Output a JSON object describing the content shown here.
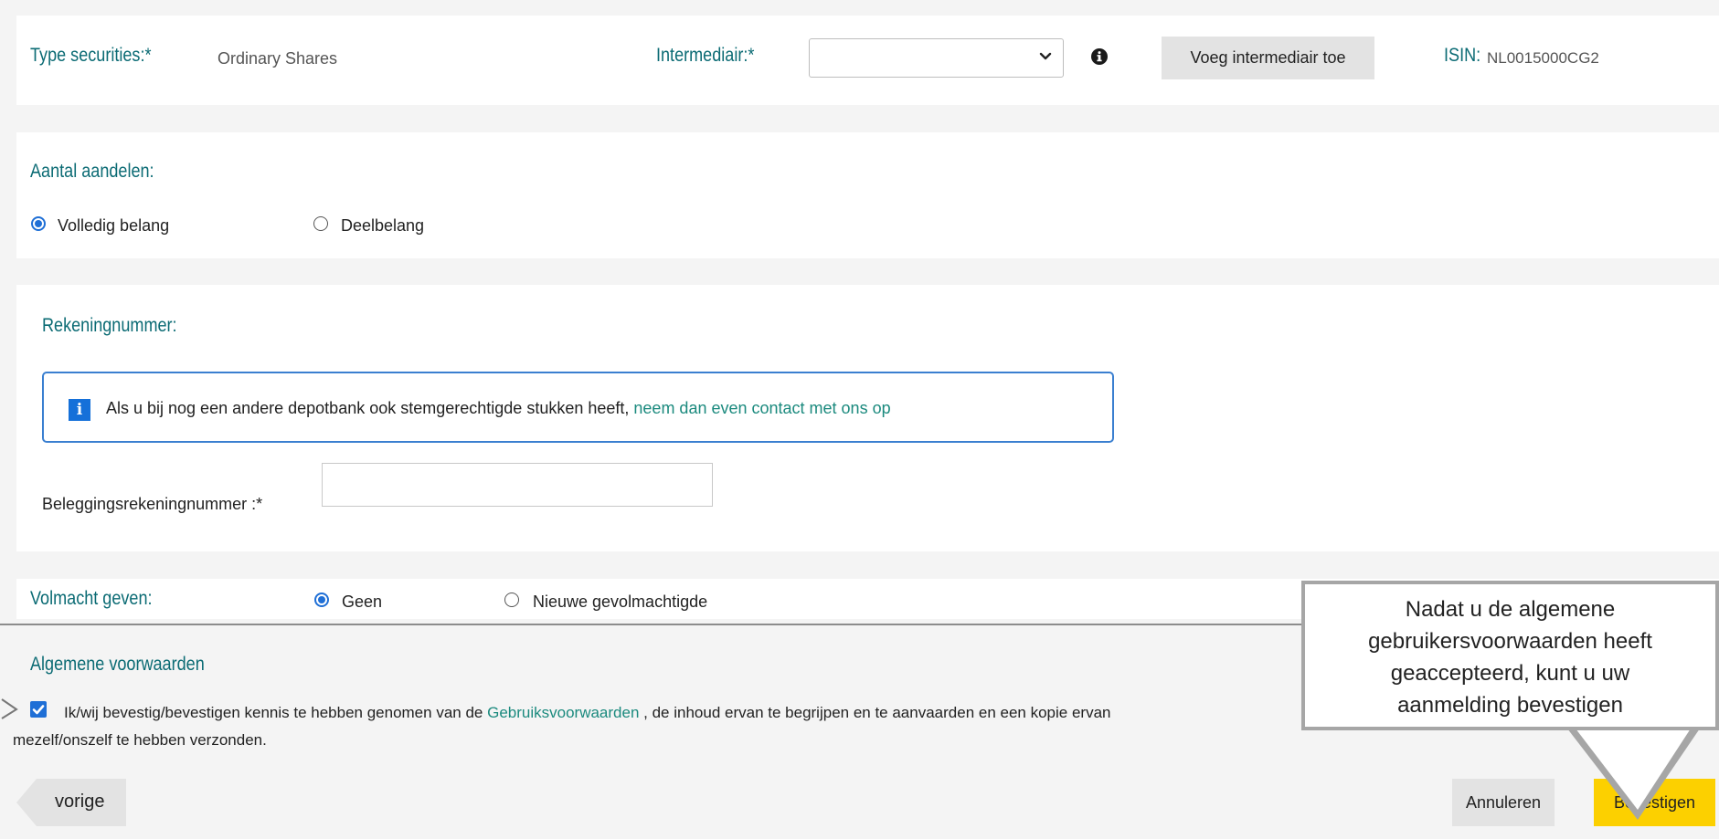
{
  "securities": {
    "type_label": "Type securities:*",
    "type_value": "Ordinary Shares",
    "intermediary_label": "Intermediair:*",
    "intermediary_selected": "",
    "add_intermediary_button": "Voeg intermediair toe",
    "isin_label": "ISIN:",
    "isin_value": "NL0015000CG2"
  },
  "shares": {
    "heading": "Aantal aandelen:",
    "options": [
      {
        "label": "Volledig belang",
        "selected": true
      },
      {
        "label": "Deelbelang",
        "selected": false
      }
    ]
  },
  "account": {
    "heading": "Rekeningnummer:",
    "info_text": "Als u bij nog een andere depotbank ook stemgerechtigde stukken heeft,",
    "info_link": "neem dan even contact met ons op",
    "account_label": "Beleggingsrekeningnummer :*",
    "account_value": ""
  },
  "proxy": {
    "heading": "Volmacht geven:",
    "options": [
      {
        "label": "Geen",
        "selected": true
      },
      {
        "label": "Nieuwe gevolmachtigde",
        "selected": false
      }
    ]
  },
  "terms": {
    "heading": "Algemene voorwaarden",
    "checked": true,
    "text_before": "Ik/wij bevestig/bevestigen kennis te hebben genomen van de",
    "link": "Gebruiksvoorwaarden",
    "text_after": ", de inhoud ervan te begrijpen en te aanvaarden en een kopie ervan",
    "text_line2": "mezelf/onszelf te hebben verzonden."
  },
  "nav": {
    "previous_button": "vorige",
    "cancel_button": "Annuleren",
    "confirm_button": "Bevestigen"
  },
  "callout": {
    "lines": [
      "Nadat u de algemene",
      "gebruikersvoorwaarden heeft",
      "geaccepteerd, kunt u uw",
      "aanmelding bevestigen"
    ]
  },
  "colors": {
    "teal_label": "#0b6b74",
    "link_teal": "#1b8a7e",
    "confirm_yellow": "#fcd000",
    "info_blue": "#1570d9",
    "radio_blue": "#1f6fd6"
  }
}
